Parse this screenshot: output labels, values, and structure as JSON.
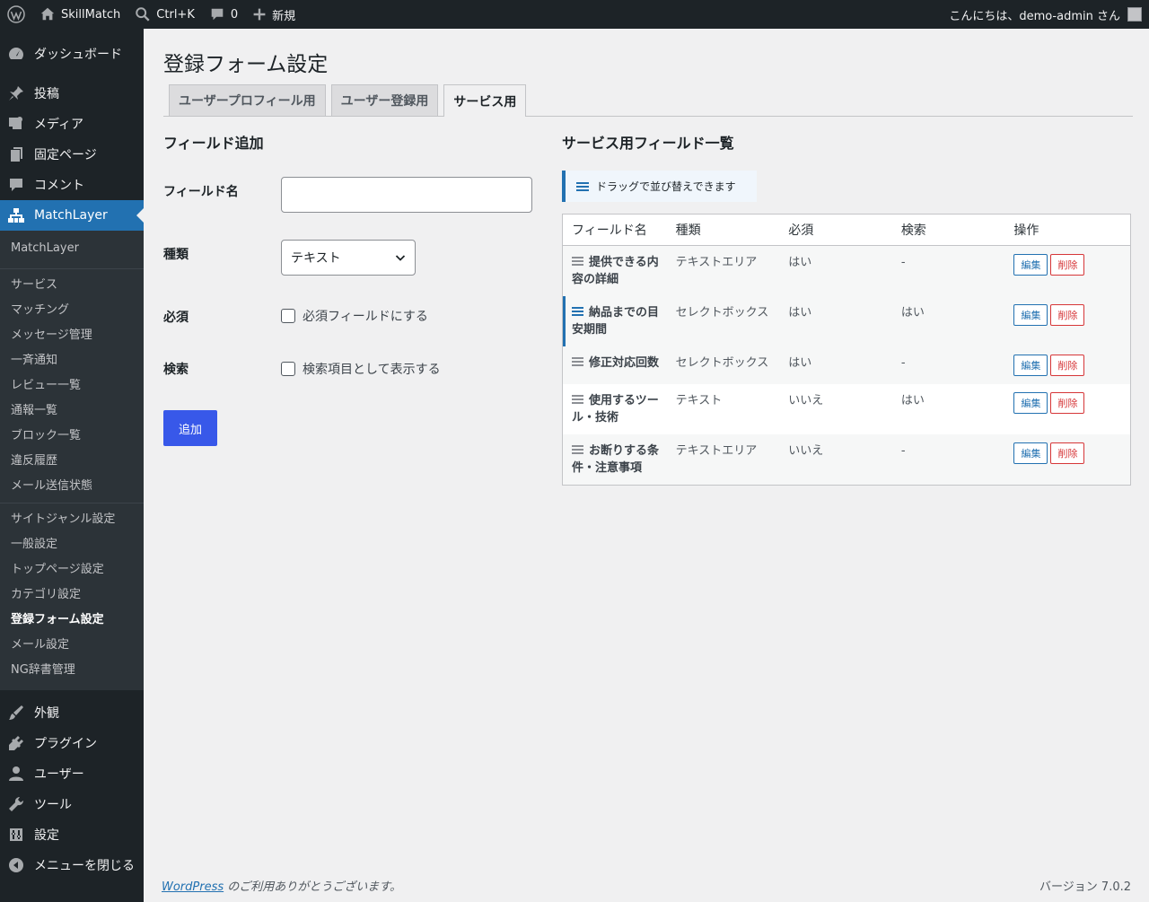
{
  "adminbar": {
    "site_name": "SkillMatch",
    "search_shortcut": "Ctrl+K",
    "comments_count": "0",
    "new_label": "新規",
    "greeting": "こんにちは、demo-admin さん"
  },
  "sidebar": {
    "top_items": [
      {
        "label": "ダッシュボード",
        "icon": "dashboard-icon"
      },
      {
        "label": "投稿",
        "icon": "pin-icon"
      },
      {
        "label": "メディア",
        "icon": "media-icon"
      },
      {
        "label": "固定ページ",
        "icon": "page-icon"
      },
      {
        "label": "コメント",
        "icon": "comment-icon"
      },
      {
        "label": "MatchLayer",
        "icon": "network-icon"
      }
    ],
    "submenu_1": [
      "MatchLayer"
    ],
    "submenu_2": [
      "サービス",
      "マッチング",
      "メッセージ管理",
      "一斉通知",
      "レビュー一覧",
      "通報一覧",
      "ブロック一覧",
      "違反履歴",
      "メール送信状態"
    ],
    "submenu_3": [
      "サイトジャンル設定",
      "一般設定",
      "トップページ設定",
      "カテゴリ設定",
      "登録フォーム設定",
      "メール設定",
      "NG辞書管理"
    ],
    "bottom_items": [
      {
        "label": "外観",
        "icon": "brush-icon"
      },
      {
        "label": "プラグイン",
        "icon": "plugin-icon"
      },
      {
        "label": "ユーザー",
        "icon": "user-icon"
      },
      {
        "label": "ツール",
        "icon": "wrench-icon"
      },
      {
        "label": "設定",
        "icon": "settings-icon"
      },
      {
        "label": "メニューを閉じる",
        "icon": "collapse-icon"
      }
    ]
  },
  "main": {
    "title": "登録フォーム設定",
    "tabs": [
      "ユーザープロフィール用",
      "ユーザー登録用",
      "サービス用"
    ],
    "add_section": {
      "title": "フィールド追加",
      "field_name_label": "フィールド名",
      "field_name_value": "",
      "type_label": "種類",
      "type_value": "テキスト",
      "required_label": "必須",
      "required_checkbox": "必須フィールドにする",
      "search_label": "検索",
      "search_checkbox": "検索項目として表示する",
      "add_button": "追加"
    },
    "list_section": {
      "title": "サービス用フィールド一覧",
      "notice": "ドラッグで並び替えできます",
      "headers": [
        "フィールド名",
        "種類",
        "必須",
        "検索",
        "操作"
      ],
      "rows": [
        {
          "name_l1": "提供できる内",
          "name_l2": "容の詳細",
          "type": "テキストエリア",
          "required": "はい",
          "search": "-"
        },
        {
          "name_l1": "納品までの目",
          "name_l2": "安期間",
          "type": "セレクトボックス",
          "required": "はい",
          "search": "はい"
        },
        {
          "name_l1": "修正対応回数",
          "name_l2": "",
          "type": "セレクトボックス",
          "required": "はい",
          "search": "-"
        },
        {
          "name_l1": "使用するツー",
          "name_l2": "ル・技術",
          "type": "テキスト",
          "required": "いいえ",
          "search": "はい"
        },
        {
          "name_l1": "お断りする条",
          "name_l2": "件・注意事項",
          "type": "テキストエリア",
          "required": "いいえ",
          "search": "-"
        }
      ],
      "edit_label": "編集",
      "delete_label": "削除"
    }
  },
  "footer": {
    "link": "WordPress",
    "text": " のご利用ありがとうございます。",
    "version": "バージョン 7.0.2"
  }
}
